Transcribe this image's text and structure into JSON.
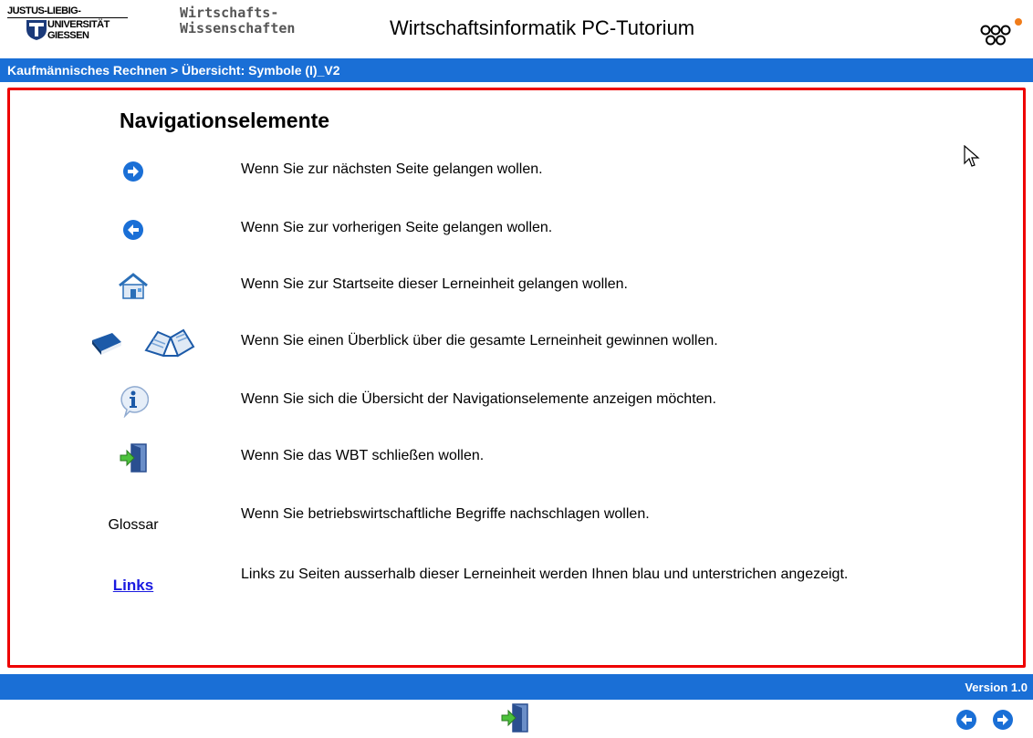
{
  "header": {
    "logo_line1": "JUSTUS-LIEBIG-",
    "logo_line2": "UNIVERSITÄT",
    "logo_line3": "GIESSEN",
    "faculty_line1": "Wirtschafts-",
    "faculty_line2": "Wissenschaften",
    "app_title": "Wirtschaftsinformatik PC-Tutorium",
    "menu_icon": "ooo-logo-icon",
    "accent_color": "#f07c1a"
  },
  "breadcrumb": {
    "text": "Kaufmännisches Rechnen > Übersicht: Symbole (I)_V2",
    "bar_color": "#1a6fd6"
  },
  "main": {
    "title": "Navigationselemente",
    "frame_color": "#ee0000",
    "rows": [
      {
        "icon": "arrow-right-icon",
        "description": "Wenn Sie zur nächsten Seite gelangen wollen."
      },
      {
        "icon": "arrow-left-icon",
        "description": "Wenn Sie zur vorherigen Seite gelangen wollen."
      },
      {
        "icon": "home-icon",
        "description": "Wenn Sie zur Startseite dieser Lerneinheit gelangen wollen."
      },
      {
        "icon": "book-icon",
        "description": "Wenn Sie einen Überblick über die gesamte Lerneinheit gewinnen wollen."
      },
      {
        "icon": "info-icon",
        "description": "Wenn Sie sich die Übersicht der Navigationselemente anzeigen möchten."
      },
      {
        "icon": "exit-door-icon",
        "description": "Wenn Sie das WBT schließen wollen."
      },
      {
        "label": "Glossar",
        "description": "Wenn Sie betriebswirtschaftliche Begriffe nachschlagen wollen."
      },
      {
        "label": "Links",
        "description": "Links zu Seiten ausserhalb dieser Lerneinheit werden Ihnen blau und unterstrichen angezeigt."
      }
    ]
  },
  "footer": {
    "version": "Version 1.0",
    "exit_icon": "exit-door-icon",
    "prev_icon": "arrow-left-icon",
    "next_icon": "arrow-right-icon"
  }
}
